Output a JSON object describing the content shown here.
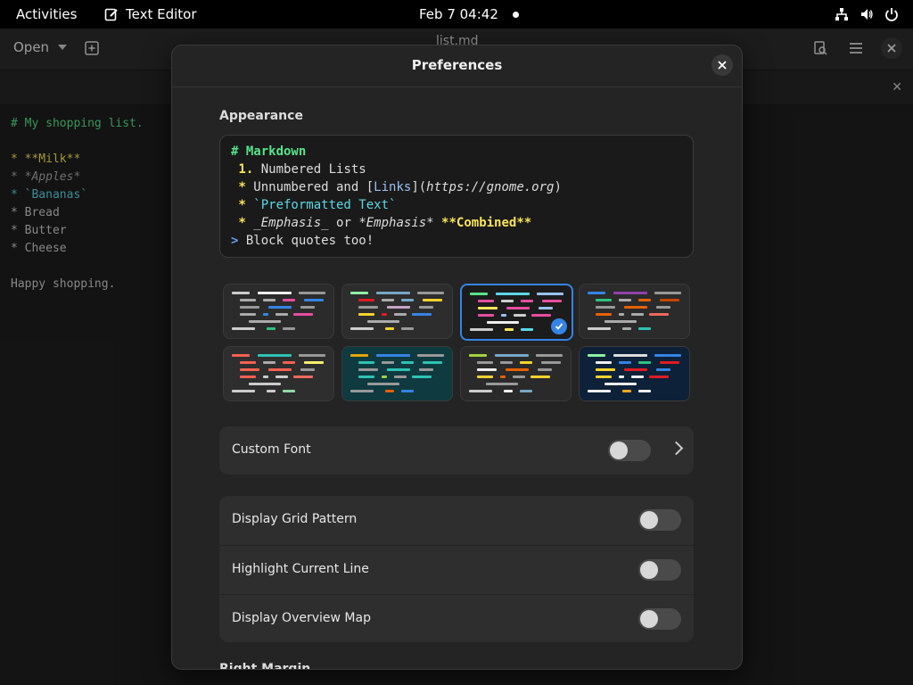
{
  "topbar": {
    "activities": "Activities",
    "app_name": "Text Editor",
    "clock": "Feb 7  04:42"
  },
  "headerbar": {
    "open_label": "Open",
    "window_title": "list.md"
  },
  "editor": {
    "lines": [
      "# My shopping list.",
      "",
      "* **Milk**",
      "* *Apples*",
      "* `Bananas`",
      "* Bread",
      "* Butter",
      "* Cheese",
      "",
      "Happy shopping."
    ]
  },
  "dialog": {
    "title": "Preferences",
    "appearance_title": "Appearance",
    "preview": {
      "l1": "# Markdown",
      "l2_num": " 1.",
      "l2_text": " Numbered Lists",
      "l3_star": " *",
      "l3_a": " Unnumbered and [",
      "l3_link": "Links",
      "l3_b": "](",
      "l3_url": "https://gnome.org",
      "l3_c": ")",
      "l4_star": " *",
      "l4_code": " `Preformatted Text`",
      "l5_star": " *",
      "l5_a": " ",
      "l5_em1": "_Emphasis_",
      "l5_b": " or ",
      "l5_em2": "*Emphasis*",
      "l5_c": " ",
      "l5_strong": "**Combined**",
      "l6_gt": ">",
      "l6_text": " Block quotes too!"
    },
    "selected_scheme": 3,
    "custom_font_label": "Custom Font",
    "custom_font_on": false,
    "display_grid_label": "Display Grid Pattern",
    "display_grid_on": false,
    "highlight_line_label": "Highlight Current Line",
    "highlight_line_on": false,
    "overview_map_label": "Display Overview Map",
    "overview_map_on": false,
    "right_margin_label": "Right Margin"
  },
  "colors": {
    "accent": "#3584e4",
    "md_heading": "#57e389",
    "md_yellow": "#f8e45c",
    "md_cyan": "#5bd8e6",
    "md_link": "#99c1f1",
    "md_blue": "#62a0ea"
  }
}
